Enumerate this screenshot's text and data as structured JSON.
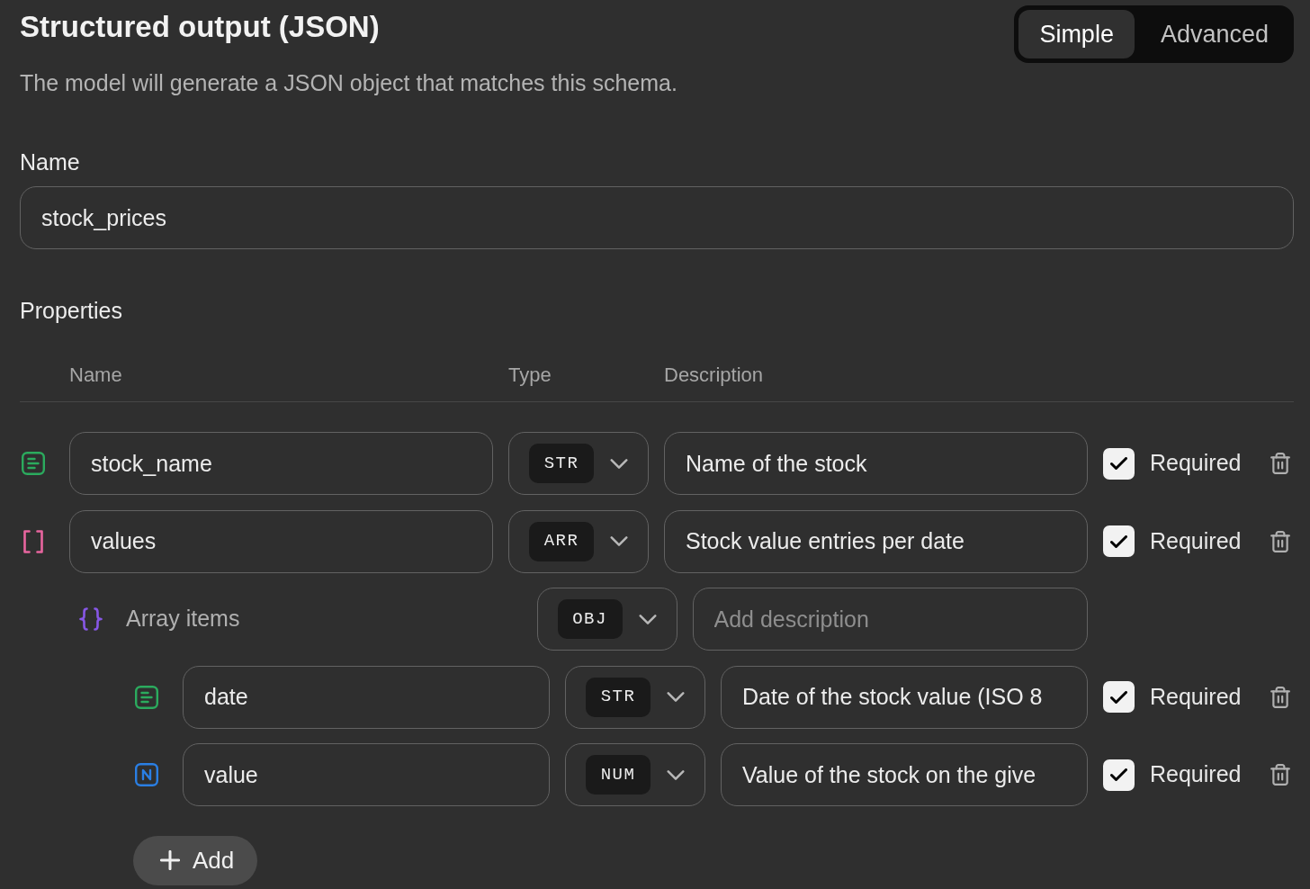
{
  "header": {
    "title": "Structured output (JSON)",
    "subtitle": "The model will generate a JSON object that matches this schema."
  },
  "mode_toggle": [
    {
      "label": "Simple",
      "selected": true
    },
    {
      "label": "Advanced",
      "selected": false
    }
  ],
  "name_field": {
    "label": "Name",
    "value": "stock_prices"
  },
  "properties": {
    "title": "Properties",
    "columns": [
      "Name",
      "Type",
      "Description"
    ],
    "rows": [
      {
        "kind": "string",
        "name": "stock_name",
        "type_badge": "STR",
        "description": {
          "value": "Name of the stock"
        },
        "required": true,
        "required_label": "Required"
      },
      {
        "kind": "array",
        "name": "values",
        "type_badge": "ARR",
        "description": {
          "value": "Stock value entries per date"
        },
        "required": true,
        "required_label": "Required",
        "children": [
          {
            "kind": "items",
            "label": "Array items",
            "type_badge": "OBJ",
            "description": {
              "placeholder": "Add description"
            },
            "add_button": "Add",
            "children": [
              {
                "kind": "string",
                "name": "date",
                "type_badge": "STR",
                "description": {
                  "value": "Date of the stock value (ISO 8"
                },
                "required": true,
                "required_label": "Required"
              },
              {
                "kind": "number",
                "name": "value",
                "type_badge": "NUM",
                "description": {
                  "value": "Value of the stock on the give"
                },
                "required": true,
                "required_label": "Required"
              }
            ]
          }
        ]
      }
    ]
  }
}
